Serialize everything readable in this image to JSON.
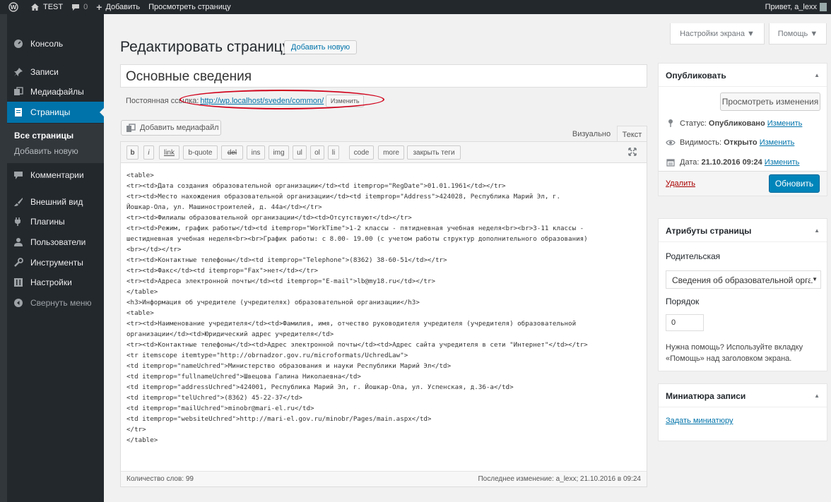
{
  "admin_bar": {
    "site_name": "TEST",
    "comments_count": "0",
    "new_label": "Добавить",
    "view_label": "Просмотреть страницу",
    "greeting": "Привет, a_lexx"
  },
  "sidebar": {
    "items": [
      {
        "label": "Консоль",
        "icon": "dashboard-icon"
      },
      {
        "label": "Записи",
        "icon": "pin-icon"
      },
      {
        "label": "Медиафайлы",
        "icon": "media-icon"
      },
      {
        "label": "Страницы",
        "icon": "page-icon"
      },
      {
        "label": "Комментарии",
        "icon": "comment-icon"
      },
      {
        "label": "Внешний вид",
        "icon": "brush-icon"
      },
      {
        "label": "Плагины",
        "icon": "plugin-icon"
      },
      {
        "label": "Пользователи",
        "icon": "users-icon"
      },
      {
        "label": "Инструменты",
        "icon": "wrench-icon"
      },
      {
        "label": "Настройки",
        "icon": "settings-icon"
      },
      {
        "label": "Свернуть меню",
        "icon": "collapse-icon"
      }
    ],
    "submenu": [
      "Все страницы",
      "Добавить новую"
    ]
  },
  "header": {
    "title": "Редактировать страницу",
    "add_new": "Добавить новую",
    "screen_options": "Настройки экрана ▼",
    "help": "Помощь ▼"
  },
  "post": {
    "title": "Основные сведения",
    "permalink_label": "Постоянная ссылка:",
    "permalink_url": "http://wp.localhost/sveden/common/",
    "edit_slug": "Изменить"
  },
  "editor": {
    "add_media": "Добавить медиафайл",
    "tab_visual": "Визуально",
    "tab_text": "Текст",
    "quicktags": [
      "b",
      "i",
      "link",
      "b-quote",
      "del",
      "ins",
      "img",
      "ul",
      "ol",
      "li",
      "code",
      "more",
      "закрыть теги"
    ],
    "content": "<table>\n<tr><td>Дата создания образовательной организации</td><td itemprop=\"RegDate\">01.01.1961</td></tr>\n<tr><td>Место нахождения образовательной организации</td><td itemprop=\"Address\">424028, Республика Марий Эл, г.\nЙошкар-Ола, ул. Машиностроителей, д. 44а</td></tr>\n<tr><td>Филиалы образовательной организации</td><td>Отсутствуют</td></tr>\n<tr><td>Режим, график работы</td><td itemprop=\"WorkTime\">1-2 классы - пятидневная учебная неделя<br><br>3-11 классы -\nшестидневная учебная неделя<br><br>График работы: с 8.00- 19.00 (с учетом работы структур дополнительного образования)\n<br></td></tr>\n<tr><td>Контактные телефоны</td><td itemprop=\"Telephone\">(8362) 38-60-51</td></tr>\n<tr><td>Факс</td><td itemprop=\"Fax\">нет</td></tr>\n<tr><td>Адреса электронной почты</td><td itemprop=\"E-mail\">lb@my18.ru</td></tr>\n</table>\n<h3>Информация об учредителе (учредителях) образовательной организации</h3>\n<table>\n<tr><td>Наименование учредителя</td><td>Фамилия, имя, отчество руководителя учредителя (учредителя) образовательной\nорганизации</td><td>Юридический адрес учредителя</td>\n<tr><td>Контактные телефоны</td><td>Адрес электронной почты</td><td>Адрес сайта учредителя в сети \"Интернет\"</td></tr>\n<tr itemscope itemtype=\"http://obrnadzor.gov.ru/microformats/UchredLaw\">\n<td itemprop=\"nameUchred\">Министерство образования и науки Республики Марий Эл</td>\n<td itemprop=\"fullnameUchred\">Швецова Галина Николаевна</td>\n<td itemprop=\"addressUchred\">424001, Республика Марий Эл, г. Йошкар-Ола, ул. Успенская, д.36-а</td>\n<td itemprop=\"telUchred\">(8362) 45-22-37</td>\n<td itemprop=\"mailUchred\">minobr@mari-el.ru</td>\n<td itemprop=\"websiteUchred\">http://mari-el.gov.ru/minobr/Pages/main.aspx</td>\n</tr>\n</table>",
    "word_count": "Количество слов: 99",
    "last_edit": "Последнее изменение: a_lexx; 21.10.2016 в 09:24"
  },
  "publish": {
    "title": "Опубликовать",
    "preview_changes": "Просмотреть изменения",
    "status_label": "Статус:",
    "status_value": "Опубликовано",
    "visibility_label": "Видимость:",
    "visibility_value": "Открыто",
    "date_label": "Дата:",
    "date_value": "21.10.2016 09:24",
    "edit_link": "Изменить",
    "delete": "Удалить",
    "update": "Обновить"
  },
  "page_attributes": {
    "title": "Атрибуты страницы",
    "parent_label": "Родительская",
    "parent_value": "Сведения об образовательной орга",
    "order_label": "Порядок",
    "order_value": "0",
    "help_text": "Нужна помощь? Используйте вкладку «Помощь» над заголовком экрана."
  },
  "thumbnail": {
    "title": "Миниатюра записи",
    "set_link": "Задать миниатюру"
  },
  "colors": {
    "admin_bar": "#23282d",
    "accent": "#0073aa",
    "primary_button": "#0085ba",
    "annotation": "#d0021b"
  }
}
